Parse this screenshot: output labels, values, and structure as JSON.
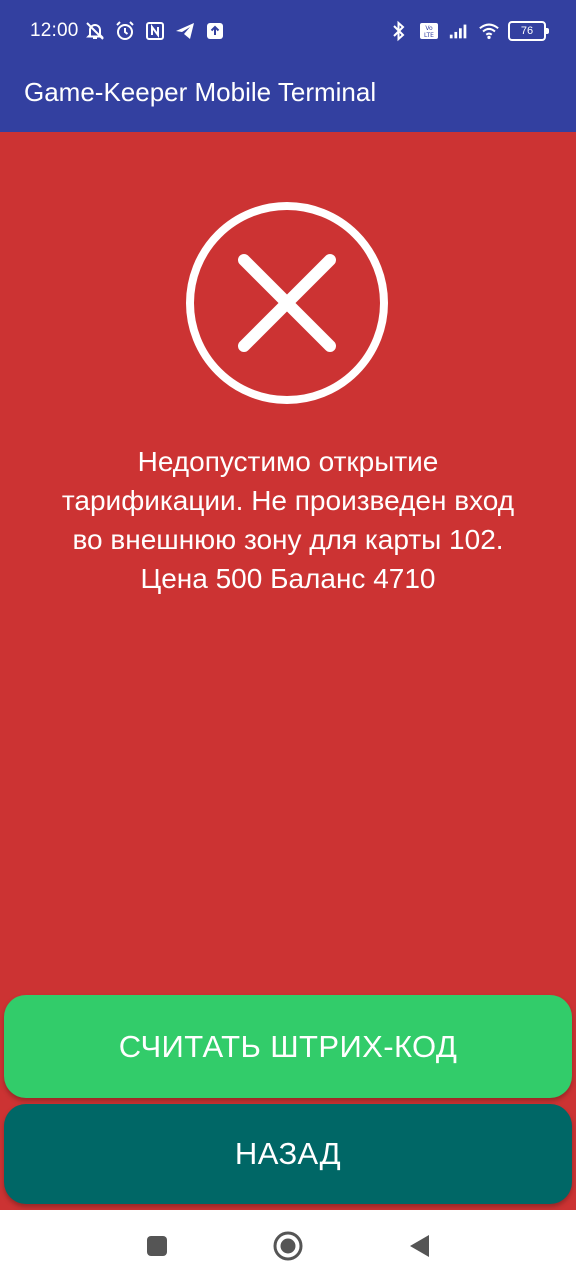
{
  "status_bar": {
    "time": "12:00",
    "left_icons": [
      "muted-notifications-icon",
      "alarm-icon",
      "nfc-icon",
      "telegram-icon",
      "upload-icon"
    ],
    "right_icons": [
      "bluetooth-icon",
      "volte-icon",
      "signal-icon",
      "wifi-icon"
    ],
    "battery_level": "76"
  },
  "app_bar": {
    "title": "Game-Keeper Mobile Terminal"
  },
  "error": {
    "icon": "close-circle-icon",
    "message": "Недопустимо открытие\nтарификации.  Не произведен вход\nво внешнюю зону для карты 102.\nЦена  500 Баланс  4710"
  },
  "actions": {
    "scan_label": "СЧИТАТЬ ШТРИХ-КОД",
    "back_label": "НАЗАД"
  },
  "nav_bar": {
    "items": [
      "recents-icon",
      "home-icon",
      "back-icon"
    ]
  },
  "colors": {
    "primary": "#3340A0",
    "error_background": "#CC3333",
    "scan_button": "#32CC6A",
    "back_button": "#006766"
  }
}
